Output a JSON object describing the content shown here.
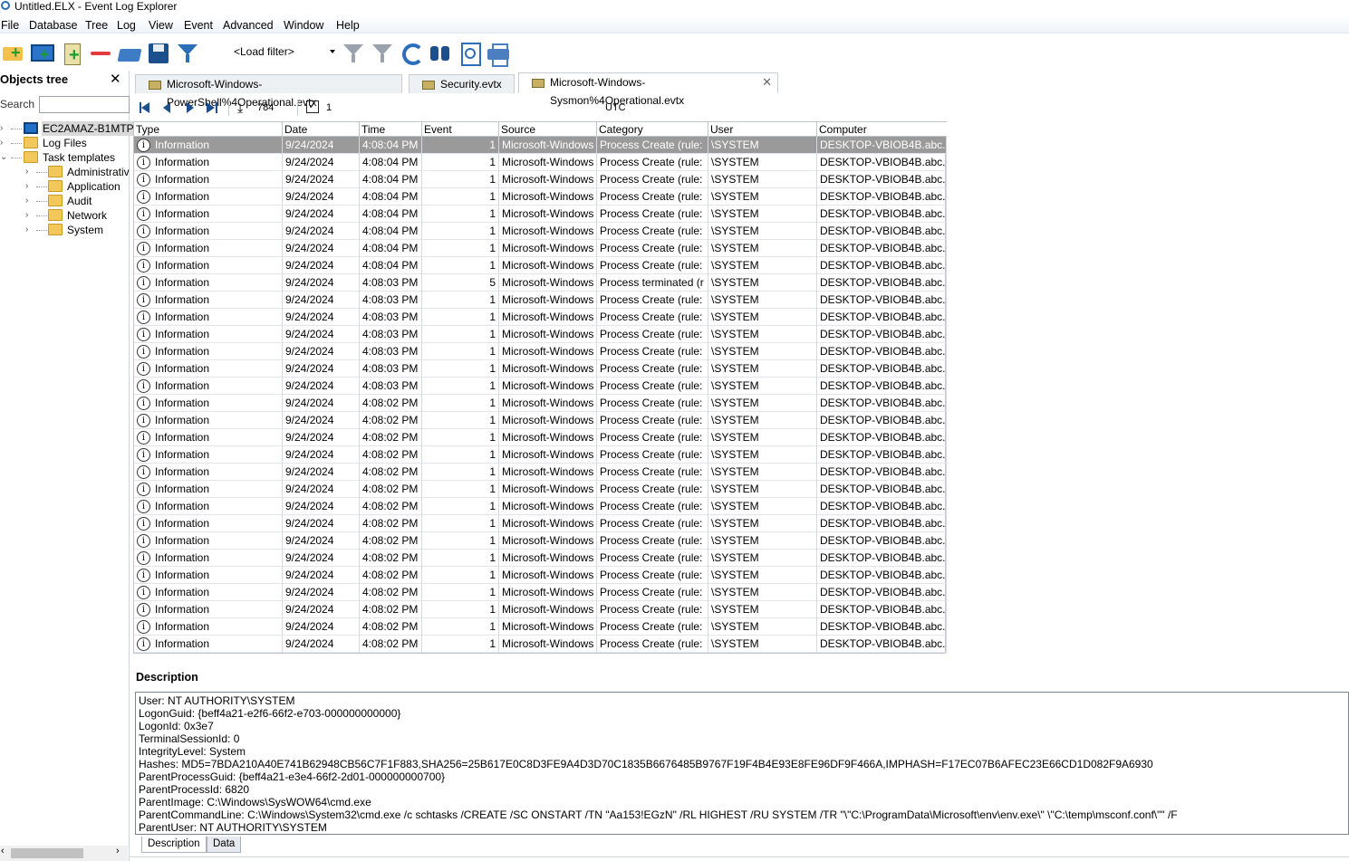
{
  "window": {
    "title": "Untitled.ELX - Event Log Explorer"
  },
  "menu": [
    "File",
    "Database",
    "Tree",
    "Log",
    "View",
    "Event",
    "Advanced",
    "Window",
    "Help"
  ],
  "toolbar": {
    "load_filter": "<Load filter>",
    "icons": [
      "add-folder-icon",
      "add-computer-icon",
      "add-log-icon",
      "remove-icon",
      "open-icon",
      "save-icon",
      "filter-icon",
      "filter-gray-icon",
      "filter-clear-icon",
      "refresh-icon",
      "find-icon",
      "preview-icon",
      "print-icon"
    ]
  },
  "objects_tree": {
    "title": "Objects tree",
    "close": "✕",
    "search_label": "Search",
    "search_value": "",
    "items": [
      {
        "label": "EC2AMAZ-B1MTP",
        "icon": "monitor-icon",
        "expander": "›",
        "selected": true
      },
      {
        "label": "Log Files",
        "icon": "folder-icon",
        "expander": "›"
      },
      {
        "label": "Task templates",
        "icon": "folder-icon",
        "expander": "⌄"
      },
      {
        "label": "Administrativ",
        "icon": "folder-icon",
        "expander": "›"
      },
      {
        "label": "Application",
        "icon": "folder-icon",
        "expander": "›"
      },
      {
        "label": "Audit",
        "icon": "folder-icon",
        "expander": "›"
      },
      {
        "label": "Network",
        "icon": "folder-icon",
        "expander": "›"
      },
      {
        "label": "System",
        "icon": "folder-icon",
        "expander": "›"
      }
    ]
  },
  "tabs": [
    {
      "label": "Microsoft-Windows-PowerShell%4Operational.evtx"
    },
    {
      "label": "Security.evtx"
    },
    {
      "label": "Microsoft-Windows-Sysmon%4Operational.evtx",
      "close": "✕",
      "active": true
    }
  ],
  "navbar": {
    "count": "784",
    "checked": "1",
    "check_mark": "✓",
    "download": "⤓",
    "timezone": "UTC"
  },
  "columns": [
    "Type",
    "Date",
    "Time",
    "Event",
    "Source",
    "Category",
    "User",
    "Computer"
  ],
  "rows": [
    {
      "type": "Information",
      "date": "9/24/2024",
      "time": "4:08:04 PM",
      "event": "1",
      "source": "Microsoft-Windows",
      "category": "Process Create (rule:",
      "user": "\\SYSTEM",
      "computer": "DESKTOP-VBIOB4B.abc.lo"
    },
    {
      "type": "Information",
      "date": "9/24/2024",
      "time": "4:08:04 PM",
      "event": "1",
      "source": "Microsoft-Windows",
      "category": "Process Create (rule:",
      "user": "\\SYSTEM",
      "computer": "DESKTOP-VBIOB4B.abc.lo"
    },
    {
      "type": "Information",
      "date": "9/24/2024",
      "time": "4:08:04 PM",
      "event": "1",
      "source": "Microsoft-Windows",
      "category": "Process Create (rule:",
      "user": "\\SYSTEM",
      "computer": "DESKTOP-VBIOB4B.abc.lo"
    },
    {
      "type": "Information",
      "date": "9/24/2024",
      "time": "4:08:04 PM",
      "event": "1",
      "source": "Microsoft-Windows",
      "category": "Process Create (rule:",
      "user": "\\SYSTEM",
      "computer": "DESKTOP-VBIOB4B.abc.lo"
    },
    {
      "type": "Information",
      "date": "9/24/2024",
      "time": "4:08:04 PM",
      "event": "1",
      "source": "Microsoft-Windows",
      "category": "Process Create (rule:",
      "user": "\\SYSTEM",
      "computer": "DESKTOP-VBIOB4B.abc.lo"
    },
    {
      "type": "Information",
      "date": "9/24/2024",
      "time": "4:08:04 PM",
      "event": "1",
      "source": "Microsoft-Windows",
      "category": "Process Create (rule:",
      "user": "\\SYSTEM",
      "computer": "DESKTOP-VBIOB4B.abc.lo"
    },
    {
      "type": "Information",
      "date": "9/24/2024",
      "time": "4:08:04 PM",
      "event": "1",
      "source": "Microsoft-Windows",
      "category": "Process Create (rule:",
      "user": "\\SYSTEM",
      "computer": "DESKTOP-VBIOB4B.abc.lo"
    },
    {
      "type": "Information",
      "date": "9/24/2024",
      "time": "4:08:04 PM",
      "event": "1",
      "source": "Microsoft-Windows",
      "category": "Process Create (rule:",
      "user": "\\SYSTEM",
      "computer": "DESKTOP-VBIOB4B.abc.lo"
    },
    {
      "type": "Information",
      "date": "9/24/2024",
      "time": "4:08:03 PM",
      "event": "5",
      "source": "Microsoft-Windows",
      "category": "Process terminated (r",
      "user": "\\SYSTEM",
      "computer": "DESKTOP-VBIOB4B.abc.lo"
    },
    {
      "type": "Information",
      "date": "9/24/2024",
      "time": "4:08:03 PM",
      "event": "1",
      "source": "Microsoft-Windows",
      "category": "Process Create (rule:",
      "user": "\\SYSTEM",
      "computer": "DESKTOP-VBIOB4B.abc.lo"
    },
    {
      "type": "Information",
      "date": "9/24/2024",
      "time": "4:08:03 PM",
      "event": "1",
      "source": "Microsoft-Windows",
      "category": "Process Create (rule:",
      "user": "\\SYSTEM",
      "computer": "DESKTOP-VBIOB4B.abc.lo"
    },
    {
      "type": "Information",
      "date": "9/24/2024",
      "time": "4:08:03 PM",
      "event": "1",
      "source": "Microsoft-Windows",
      "category": "Process Create (rule:",
      "user": "\\SYSTEM",
      "computer": "DESKTOP-VBIOB4B.abc.lo"
    },
    {
      "type": "Information",
      "date": "9/24/2024",
      "time": "4:08:03 PM",
      "event": "1",
      "source": "Microsoft-Windows",
      "category": "Process Create (rule:",
      "user": "\\SYSTEM",
      "computer": "DESKTOP-VBIOB4B.abc.lo"
    },
    {
      "type": "Information",
      "date": "9/24/2024",
      "time": "4:08:03 PM",
      "event": "1",
      "source": "Microsoft-Windows",
      "category": "Process Create (rule:",
      "user": "\\SYSTEM",
      "computer": "DESKTOP-VBIOB4B.abc.lo"
    },
    {
      "type": "Information",
      "date": "9/24/2024",
      "time": "4:08:03 PM",
      "event": "1",
      "source": "Microsoft-Windows",
      "category": "Process Create (rule:",
      "user": "\\SYSTEM",
      "computer": "DESKTOP-VBIOB4B.abc.lo"
    },
    {
      "type": "Information",
      "date": "9/24/2024",
      "time": "4:08:02 PM",
      "event": "1",
      "source": "Microsoft-Windows",
      "category": "Process Create (rule:",
      "user": "\\SYSTEM",
      "computer": "DESKTOP-VBIOB4B.abc.lo"
    },
    {
      "type": "Information",
      "date": "9/24/2024",
      "time": "4:08:02 PM",
      "event": "1",
      "source": "Microsoft-Windows",
      "category": "Process Create (rule:",
      "user": "\\SYSTEM",
      "computer": "DESKTOP-VBIOB4B.abc.lo"
    },
    {
      "type": "Information",
      "date": "9/24/2024",
      "time": "4:08:02 PM",
      "event": "1",
      "source": "Microsoft-Windows",
      "category": "Process Create (rule:",
      "user": "\\SYSTEM",
      "computer": "DESKTOP-VBIOB4B.abc.lo"
    },
    {
      "type": "Information",
      "date": "9/24/2024",
      "time": "4:08:02 PM",
      "event": "1",
      "source": "Microsoft-Windows",
      "category": "Process Create (rule:",
      "user": "\\SYSTEM",
      "computer": "DESKTOP-VBIOB4B.abc.lo"
    },
    {
      "type": "Information",
      "date": "9/24/2024",
      "time": "4:08:02 PM",
      "event": "1",
      "source": "Microsoft-Windows",
      "category": "Process Create (rule:",
      "user": "\\SYSTEM",
      "computer": "DESKTOP-VBIOB4B.abc.lo"
    },
    {
      "type": "Information",
      "date": "9/24/2024",
      "time": "4:08:02 PM",
      "event": "1",
      "source": "Microsoft-Windows",
      "category": "Process Create (rule:",
      "user": "\\SYSTEM",
      "computer": "DESKTOP-VBIOB4B.abc.lo"
    },
    {
      "type": "Information",
      "date": "9/24/2024",
      "time": "4:08:02 PM",
      "event": "1",
      "source": "Microsoft-Windows",
      "category": "Process Create (rule:",
      "user": "\\SYSTEM",
      "computer": "DESKTOP-VBIOB4B.abc.lo"
    },
    {
      "type": "Information",
      "date": "9/24/2024",
      "time": "4:08:02 PM",
      "event": "1",
      "source": "Microsoft-Windows",
      "category": "Process Create (rule:",
      "user": "\\SYSTEM",
      "computer": "DESKTOP-VBIOB4B.abc.lo"
    },
    {
      "type": "Information",
      "date": "9/24/2024",
      "time": "4:08:02 PM",
      "event": "1",
      "source": "Microsoft-Windows",
      "category": "Process Create (rule:",
      "user": "\\SYSTEM",
      "computer": "DESKTOP-VBIOB4B.abc.lo"
    },
    {
      "type": "Information",
      "date": "9/24/2024",
      "time": "4:08:02 PM",
      "event": "1",
      "source": "Microsoft-Windows",
      "category": "Process Create (rule:",
      "user": "\\SYSTEM",
      "computer": "DESKTOP-VBIOB4B.abc.lo"
    },
    {
      "type": "Information",
      "date": "9/24/2024",
      "time": "4:08:02 PM",
      "event": "1",
      "source": "Microsoft-Windows",
      "category": "Process Create (rule:",
      "user": "\\SYSTEM",
      "computer": "DESKTOP-VBIOB4B.abc.lo"
    },
    {
      "type": "Information",
      "date": "9/24/2024",
      "time": "4:08:02 PM",
      "event": "1",
      "source": "Microsoft-Windows",
      "category": "Process Create (rule:",
      "user": "\\SYSTEM",
      "computer": "DESKTOP-VBIOB4B.abc.lo"
    },
    {
      "type": "Information",
      "date": "9/24/2024",
      "time": "4:08:02 PM",
      "event": "1",
      "source": "Microsoft-Windows",
      "category": "Process Create (rule:",
      "user": "\\SYSTEM",
      "computer": "DESKTOP-VBIOB4B.abc.lo"
    },
    {
      "type": "Information",
      "date": "9/24/2024",
      "time": "4:08:02 PM",
      "event": "1",
      "source": "Microsoft-Windows",
      "category": "Process Create (rule:",
      "user": "\\SYSTEM",
      "computer": "DESKTOP-VBIOB4B.abc.lo"
    },
    {
      "type": "Information",
      "date": "9/24/2024",
      "time": "4:08:02 PM",
      "event": "1",
      "source": "Microsoft-Windows",
      "category": "Process Create (rule:",
      "user": "\\SYSTEM",
      "computer": "DESKTOP-VBIOB4B.abc.lo"
    }
  ],
  "description": {
    "title": "Description",
    "lines": [
      "User: NT AUTHORITY\\SYSTEM",
      "LogonGuid: {beff4a21-e2f6-66f2-e703-000000000000}",
      "LogonId: 0x3e7",
      "TerminalSessionId: 0",
      "IntegrityLevel: System",
      "Hashes: MD5=7BDA210A40E741B62948CB56C7F1F883,SHA256=25B617E0C8D3FE9A4D3D70C1835B6676485B9767F19F4B4E93E8FE96DF9F466A,IMPHASH=F17EC07B6AFEC23E66CD1D082F9A6930",
      "ParentProcessGuid: {beff4a21-e3e4-66f2-2d01-000000000700}",
      "ParentProcessId: 6820",
      "ParentImage: C:\\Windows\\SysWOW64\\cmd.exe",
      "ParentCommandLine: C:\\Windows\\System32\\cmd.exe /c schtasks /CREATE /SC ONSTART /TN \"Aa153!EGzN\" /RL HIGHEST /RU SYSTEM /TR \"\\\"C:\\ProgramData\\Microsoft\\env\\env.exe\\\" \\\"C:\\temp\\msconf.conf\\\"\" /F",
      "ParentUser: NT AUTHORITY\\SYSTEM"
    ],
    "tabs": [
      "Description",
      "Data"
    ]
  }
}
